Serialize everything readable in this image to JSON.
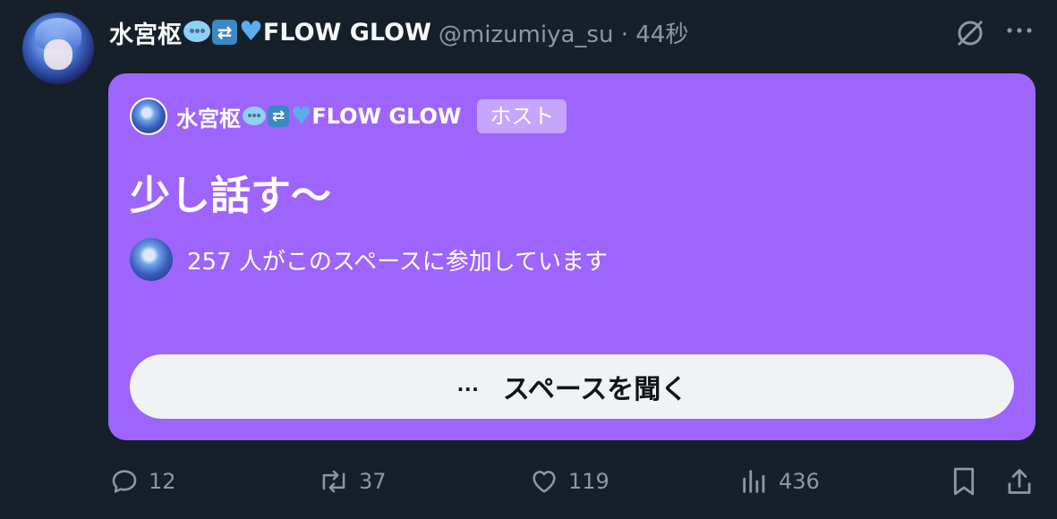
{
  "tweet": {
    "author": {
      "display_name": "水宮枢",
      "display_name_suffix": "FLOW GLOW",
      "emojis": [
        "speech-bubble-emoji",
        "repeat-button-emoji",
        "blue-heart-emoji"
      ],
      "handle_and_time": "@mizumiya_su · 44秒"
    }
  },
  "space_card": {
    "host_name": "水宮枢",
    "host_name_suffix": "FLOW GLOW",
    "host_badge": "ホスト",
    "title": "少し話す～",
    "listener_text": "257 人がこのスペースに参加しています",
    "listen_button_dots": "…",
    "listen_button_label": "スペースを聞く",
    "background_color": "#9e65fc"
  },
  "actions": {
    "reply_count": "12",
    "repost_count": "37",
    "like_count": "119",
    "views_count": "436"
  },
  "icons": {
    "grok": "grok-slash-icon",
    "more": "more-dots-icon",
    "reply": "reply-icon",
    "repost": "repost-icon",
    "like": "heart-icon",
    "views": "views-bar-chart-icon",
    "bookmark": "bookmark-icon",
    "share": "share-upload-icon"
  }
}
